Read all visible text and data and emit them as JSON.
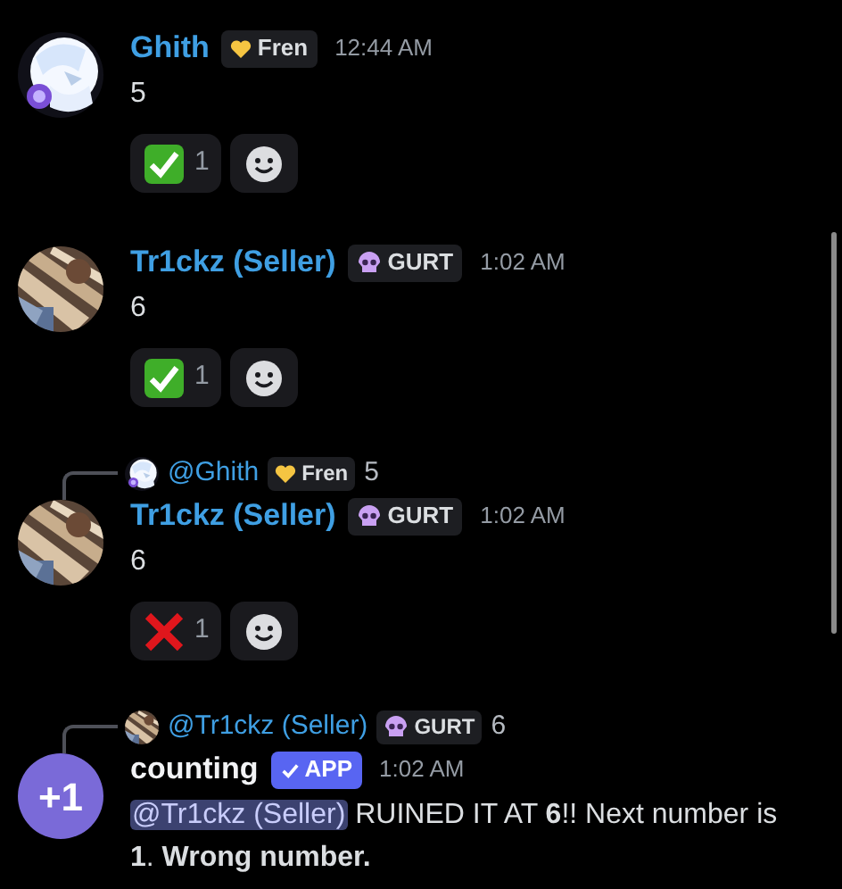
{
  "messages": [
    {
      "author": "Ghith",
      "color": "#3f9fe3",
      "tag": {
        "kind": "heart",
        "label": "Fren"
      },
      "time": "12:44 AM",
      "content": "5",
      "reactions": [
        {
          "kind": "check",
          "count": "1"
        }
      ]
    },
    {
      "author": "Tr1ckz (Seller)",
      "color": "#3f9fe3",
      "tag": {
        "kind": "skull",
        "label": "GURT"
      },
      "time": "1:02 AM",
      "content": "6",
      "reactions": [
        {
          "kind": "check",
          "count": "1"
        }
      ]
    },
    {
      "author": "Tr1ckz (Seller)",
      "color": "#3f9fe3",
      "reply": {
        "author": "@Ghith",
        "color": "#3f9fe3",
        "tag": {
          "kind": "heart",
          "label": "Fren"
        },
        "text": "5"
      },
      "tag": {
        "kind": "skull",
        "label": "GURT"
      },
      "time": "1:02 AM",
      "content": "6",
      "reactions": [
        {
          "kind": "cross",
          "count": "1"
        }
      ]
    },
    {
      "author": "counting",
      "color": "#f2f3f5",
      "avatar": {
        "kind": "text",
        "text": "+1"
      },
      "reply": {
        "author": "@Tr1ckz (Seller)",
        "color": "#3f9fe3",
        "tag": {
          "kind": "skull",
          "label": "GURT"
        },
        "text": "6"
      },
      "tag": {
        "kind": "app",
        "label": "APP"
      },
      "time": "1:02 AM",
      "mention": "@Tr1ckz (Seller)",
      "content": "RUINED IT AT **6**!! Next number is **1**. **Wrong number.**"
    }
  ]
}
